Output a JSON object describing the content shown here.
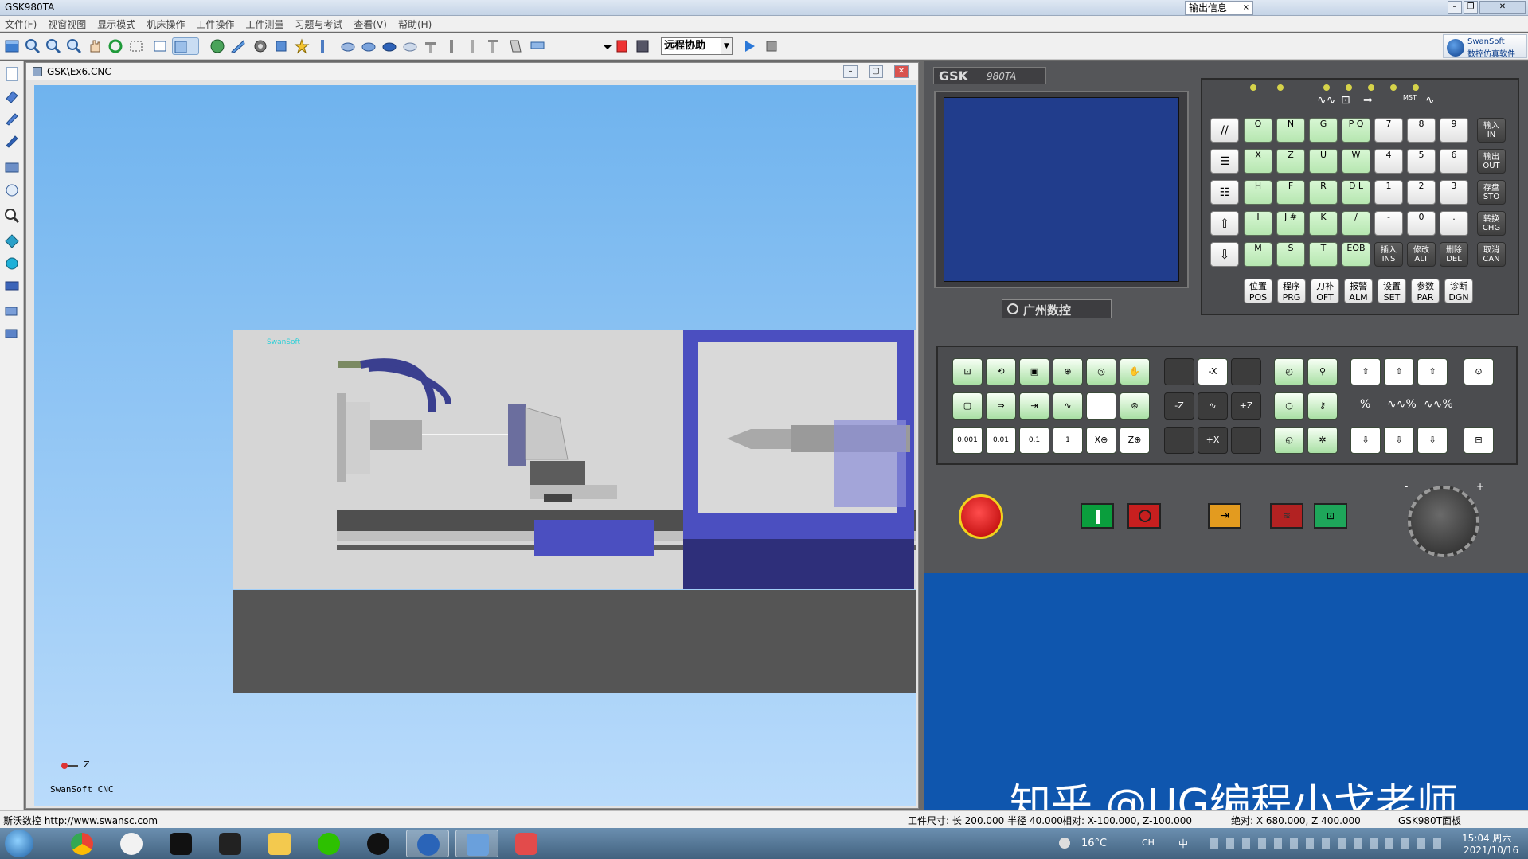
{
  "app": {
    "title": "GSK980TA",
    "output_tab": "输出信息"
  },
  "menu": [
    "文件(F)",
    "视窗视图",
    "显示模式",
    "机床操作",
    "工件操作",
    "工件测量",
    "习题与考试",
    "查看(V)",
    "帮助(H)"
  ],
  "toolbar": {
    "remote_select": "远程协助"
  },
  "brand": {
    "line1": "SwanSoft",
    "line2": "数控仿真软件"
  },
  "cnc_window": {
    "title": "GSK\\Ex6.CNC",
    "axis_label": "Z",
    "footer": "SwanSoft CNC",
    "logo_text": "SwanSoft"
  },
  "gsk_panel": {
    "model_logo": "GSK",
    "model_suffix": "980TA",
    "company": "广州数控",
    "keypad_rows": [
      [
        "O",
        "N",
        "G",
        "P Q",
        "7",
        "8",
        "9"
      ],
      [
        "X",
        "Z",
        "U",
        "W",
        "4",
        "5",
        "6"
      ],
      [
        "H",
        "F",
        "R",
        "D L",
        "1",
        "2",
        "3"
      ],
      [
        "I",
        "J #",
        "K",
        "/",
        "-",
        "0",
        "."
      ],
      [
        "M",
        "S",
        "T",
        "EOB"
      ]
    ],
    "side_keys": [
      {
        "zh": "输入",
        "en": "IN"
      },
      {
        "zh": "输出",
        "en": "OUT"
      },
      {
        "zh": "存盘",
        "en": "STO"
      },
      {
        "zh": "转换",
        "en": "CHG"
      },
      {
        "zh": "取消",
        "en": "CAN"
      }
    ],
    "edit_keys": [
      {
        "zh": "插入",
        "en": "INS"
      },
      {
        "zh": "修改",
        "en": "ALT"
      },
      {
        "zh": "删除",
        "en": "DEL"
      }
    ],
    "function_keys": [
      {
        "zh": "位置",
        "en": "POS"
      },
      {
        "zh": "程序",
        "en": "PRG"
      },
      {
        "zh": "刀补",
        "en": "OFT"
      },
      {
        "zh": "报警",
        "en": "ALM"
      },
      {
        "zh": "设置",
        "en": "SET"
      },
      {
        "zh": "参数",
        "en": "PAR"
      },
      {
        "zh": "诊断",
        "en": "DGN"
      }
    ],
    "status_label": "MST",
    "jog_keys": [
      "-X",
      "-Z",
      "+Z",
      "+X"
    ],
    "step_keys": [
      "0.001",
      "0.01",
      "0.1",
      "1"
    ],
    "zero_keys": [
      "X⊕",
      "Z⊕"
    ],
    "handwheel_minus": "-",
    "handwheel_plus": "+"
  },
  "watermark": "知乎 @UG编程小戈老师",
  "status": {
    "left": "斯沃数控 http://www.swansc.com",
    "workpiece": "工件尺寸: 长 200.000 半径 40.000",
    "relative": "相对: X-100.000, Z-100.000",
    "absolute": "绝对: X 680.000, Z 400.000",
    "panel": "GSK980T面板"
  },
  "taskbar": {
    "weather": "16°C",
    "ime": "CH",
    "ime2": "中",
    "time": "15:04 周六",
    "date": "2021/10/16"
  },
  "colors": {
    "viewport_sky": "#6fb3ee",
    "panel_blue": "#0f56ae",
    "keypad_green": "#c4f0bf",
    "lcd": "#213d8c"
  }
}
